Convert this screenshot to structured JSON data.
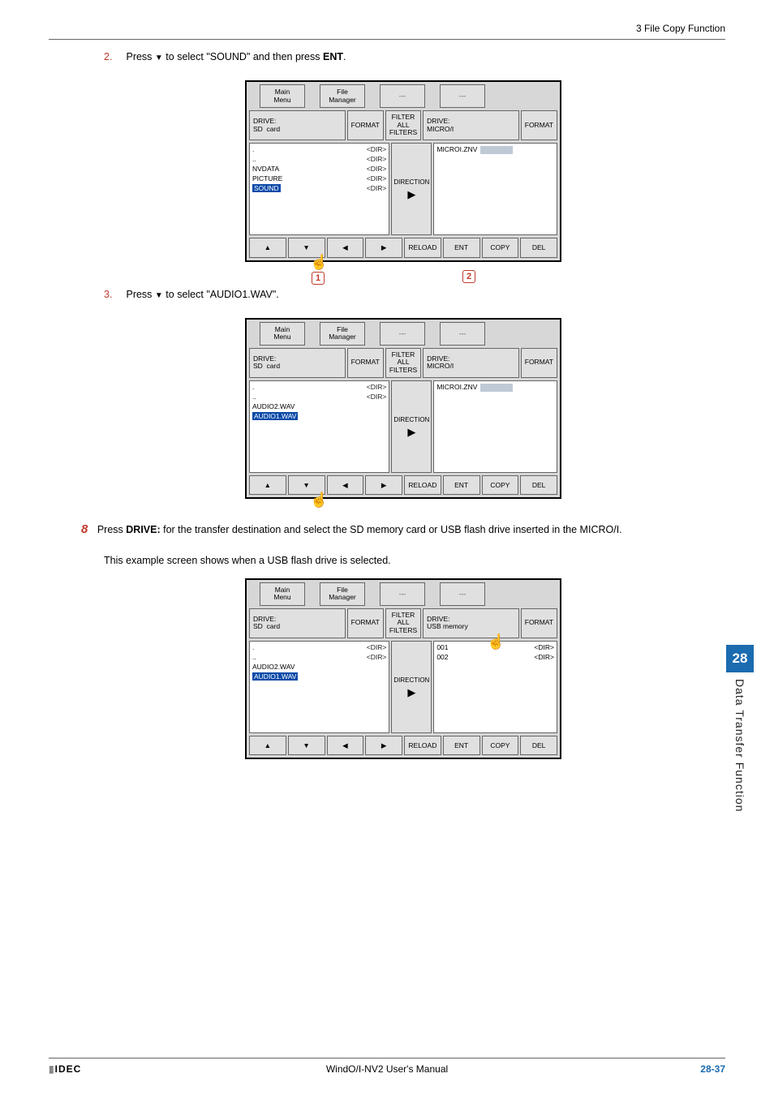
{
  "header": {
    "section": "3 File Copy Function"
  },
  "steps": {
    "s2": {
      "num": "2.",
      "pre": "Press ",
      "tri": "▼",
      "mid": " to select \"SOUND\" and then press ",
      "bold": "ENT",
      "post": "."
    },
    "s3": {
      "num": "3.",
      "pre": "Press ",
      "tri": "▼",
      "post": " to select \"AUDIO1.WAV\"."
    },
    "s8": {
      "num": "8",
      "pre": "Press ",
      "bold": "DRIVE:",
      "post": " for the transfer destination and select the SD memory card or USB flash drive inserted in the MICRO/I.",
      "desc": "This example screen shows when a USB flash drive is selected."
    }
  },
  "fm": {
    "bc1": "Main\nMenu",
    "bc2": "File\nManager",
    "bc3": "---",
    "bc4": "---",
    "drive_sd": "DRIVE:\nSD  card",
    "format": "FORMAT",
    "filter": "FILTER\nALL\nFILTERS",
    "drive_microi": "DRIVE:\nMICRO/I",
    "drive_usb": "DRIVE:\nUSB memory",
    "dirtag": "<DIR>",
    "direction": "DIRECTION",
    "microizvn": "MICROI.ZNV",
    "list1": {
      "a": ".",
      "b": "..",
      "c": "NVDATA",
      "d": "PICTURE",
      "e": "SOUND"
    },
    "list2": {
      "a": ".",
      "b": "..",
      "c": "AUDIO2.WAV",
      "d": "AUDIO1.WAV"
    },
    "list3r": {
      "a": "001",
      "b": "002"
    },
    "btn": {
      "reload": "RELOAD",
      "ent": "ENT",
      "copy": "COPY",
      "del": "DEL"
    },
    "tri": {
      "up": "▲",
      "down": "▼",
      "left": "◀",
      "right": "▶"
    }
  },
  "callouts": {
    "c1": "1",
    "c2": "2"
  },
  "sidetab": {
    "num": "28",
    "label": "Data Transfer Function"
  },
  "footer": {
    "left": "IDEC",
    "center": "WindO/I-NV2 User's Manual",
    "right_num": "28-37"
  }
}
